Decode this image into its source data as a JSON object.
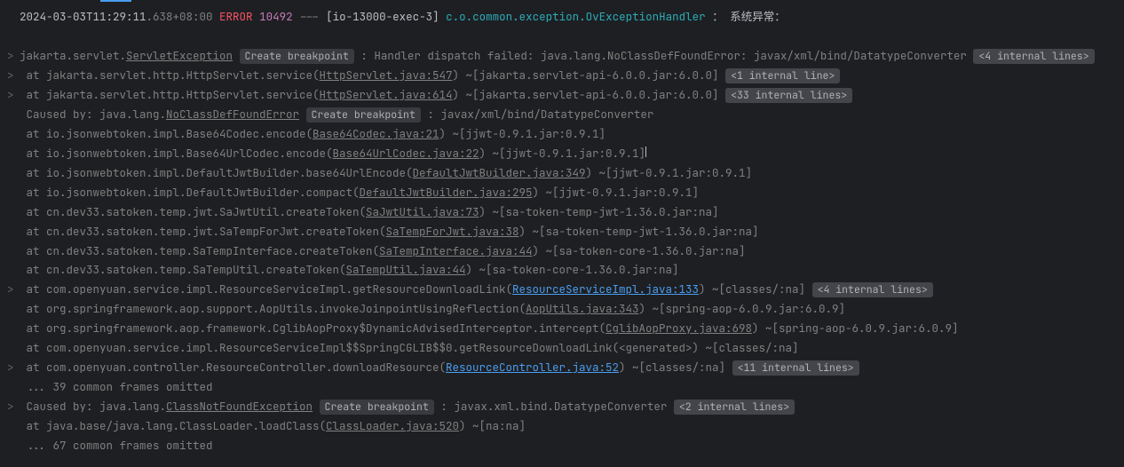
{
  "header": {
    "timestamp_main": "2024-03-03T11:29:11",
    "timestamp_ms": ".638+08:00",
    "level": "ERROR",
    "pid": "10492",
    "separator": "---",
    "thread": "[io-13000-exec-3]",
    "logger": "c.o.common.exception.OvExceptionHandler",
    "colon": "：",
    "message": "系统异常："
  },
  "line1": {
    "prefix": "jakarta.servlet.",
    "exception": "ServletException",
    "breakpoint": "Create breakpoint",
    "message": ": Handler dispatch failed: java.lang.NoClassDefFoundError: javax/xml/bind/DatatypeConverter",
    "internal": "<4 internal lines>"
  },
  "line2": {
    "at": "    at jakarta.servlet.http.HttpServlet.service(",
    "link": "HttpServlet.java:547",
    "suffix": ") ~[jakarta.servlet-api-6.0.0.jar:6.0.0]",
    "internal": "<1 internal line>"
  },
  "line3": {
    "at": "    at jakarta.servlet.http.HttpServlet.service(",
    "link": "HttpServlet.java:614",
    "suffix": ") ~[jakarta.servlet-api-6.0.0.jar:6.0.0]",
    "internal": "<33 internal lines>"
  },
  "line4": {
    "prefix": " Caused by: java.lang.",
    "exception": "NoClassDefFoundError",
    "breakpoint": "Create breakpoint",
    "message": ": javax/xml/bind/DatatypeConverter"
  },
  "line5": {
    "at": "    at io.jsonwebtoken.impl.Base64Codec.encode(",
    "link": "Base64Codec.java:21",
    "suffix": ") ~[jjwt-0.9.1.jar:0.9.1]"
  },
  "line6": {
    "at": "    at io.jsonwebtoken.impl.Base64UrlCodec.encode(",
    "link": "Base64UrlCodec.java:22",
    "suffix": ") ~[jjwt-0.9.1.jar:0.9.1]"
  },
  "line7": {
    "at": "    at io.jsonwebtoken.impl.DefaultJwtBuilder.base64UrlEncode(",
    "link": "DefaultJwtBuilder.java:349",
    "suffix": ") ~[jjwt-0.9.1.jar:0.9.1]"
  },
  "line8": {
    "at": "    at io.jsonwebtoken.impl.DefaultJwtBuilder.compact(",
    "link": "DefaultJwtBuilder.java:295",
    "suffix": ") ~[jjwt-0.9.1.jar:0.9.1]"
  },
  "line9": {
    "at": "    at cn.dev33.satoken.temp.jwt.SaJwtUtil.createToken(",
    "link": "SaJwtUtil.java:73",
    "suffix": ") ~[sa-token-temp-jwt-1.36.0.jar:na]"
  },
  "line10": {
    "at": "    at cn.dev33.satoken.temp.jwt.SaTempForJwt.createToken(",
    "link": "SaTempForJwt.java:38",
    "suffix": ") ~[sa-token-temp-jwt-1.36.0.jar:na]"
  },
  "line11": {
    "at": "    at cn.dev33.satoken.temp.SaTempInterface.createToken(",
    "link": "SaTempInterface.java:44",
    "suffix": ") ~[sa-token-core-1.36.0.jar:na]"
  },
  "line12": {
    "at": "    at cn.dev33.satoken.temp.SaTempUtil.createToken(",
    "link": "SaTempUtil.java:44",
    "suffix": ") ~[sa-token-core-1.36.0.jar:na]"
  },
  "line13": {
    "at": "    at com.openyuan.service.impl.ResourceServiceImpl.getResourceDownloadLink(",
    "link": "ResourceServiceImpl.java:133",
    "suffix": ") ~[classes/:na]",
    "internal": "<4 internal lines>"
  },
  "line14": {
    "at": "    at org.springframework.aop.support.AopUtils.invokeJoinpointUsingReflection(",
    "link": "AopUtils.java:343",
    "suffix": ") ~[spring-aop-6.0.9.jar:6.0.9]"
  },
  "line15": {
    "at": "    at org.springframework.aop.framework.CglibAopProxy$DynamicAdvisedInterceptor.intercept(",
    "link": "CglibAopProxy.java:698",
    "suffix": ") ~[spring-aop-6.0.9.jar:6.0.9]"
  },
  "line16": {
    "at": "    at com.openyuan.service.impl.ResourceServiceImpl$$SpringCGLIB$$0.getResourceDownloadLink(<generated>) ~[classes/:na]"
  },
  "line17": {
    "at": "    at com.openyuan.controller.ResourceController.downloadResource(",
    "link": "ResourceController.java:52",
    "suffix": ") ~[classes/:na]",
    "internal": "<11 internal lines>"
  },
  "line18": {
    "text": "    ... 39 common frames omitted"
  },
  "line19": {
    "prefix": " Caused by: java.lang.",
    "exception": "ClassNotFoundException",
    "breakpoint": "Create breakpoint",
    "message": ": javax.xml.bind.DatatypeConverter",
    "internal": "<2 internal lines>"
  },
  "line20": {
    "at": "    at java.base/java.lang.ClassLoader.loadClass(",
    "link": "ClassLoader.java:520",
    "suffix": ") ~[na:na]"
  },
  "line21": {
    "text": "    ... 67 common frames omitted"
  }
}
